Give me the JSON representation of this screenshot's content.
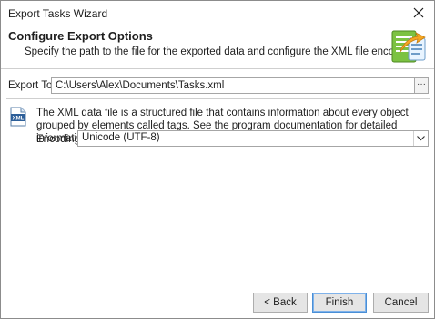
{
  "window": {
    "title": "Export Tasks Wizard"
  },
  "header": {
    "title": "Configure Export Options",
    "subtitle": "Specify the path to the file for the exported data and configure the XML file encoding.",
    "icon": "export-wizard-icon"
  },
  "export_to": {
    "label": "Export To:",
    "value": "C:\\Users\\Alex\\Documents\\Tasks.xml",
    "browse_label": "···"
  },
  "info": {
    "icon": "xml-file-icon",
    "text": "The XML data file is a structured file that contains information about every object grouped by elements called tags. See the program documentation for detailed information about the XML file format."
  },
  "encoding": {
    "label": "Encoding:",
    "selected": "Unicode (UTF-8)"
  },
  "buttons": {
    "back": "< Back",
    "finish": "Finish",
    "cancel": "Cancel"
  },
  "colors": {
    "accent": "#4a8fd6",
    "icon_green": "#7cc242",
    "icon_orange": "#f5a623"
  }
}
